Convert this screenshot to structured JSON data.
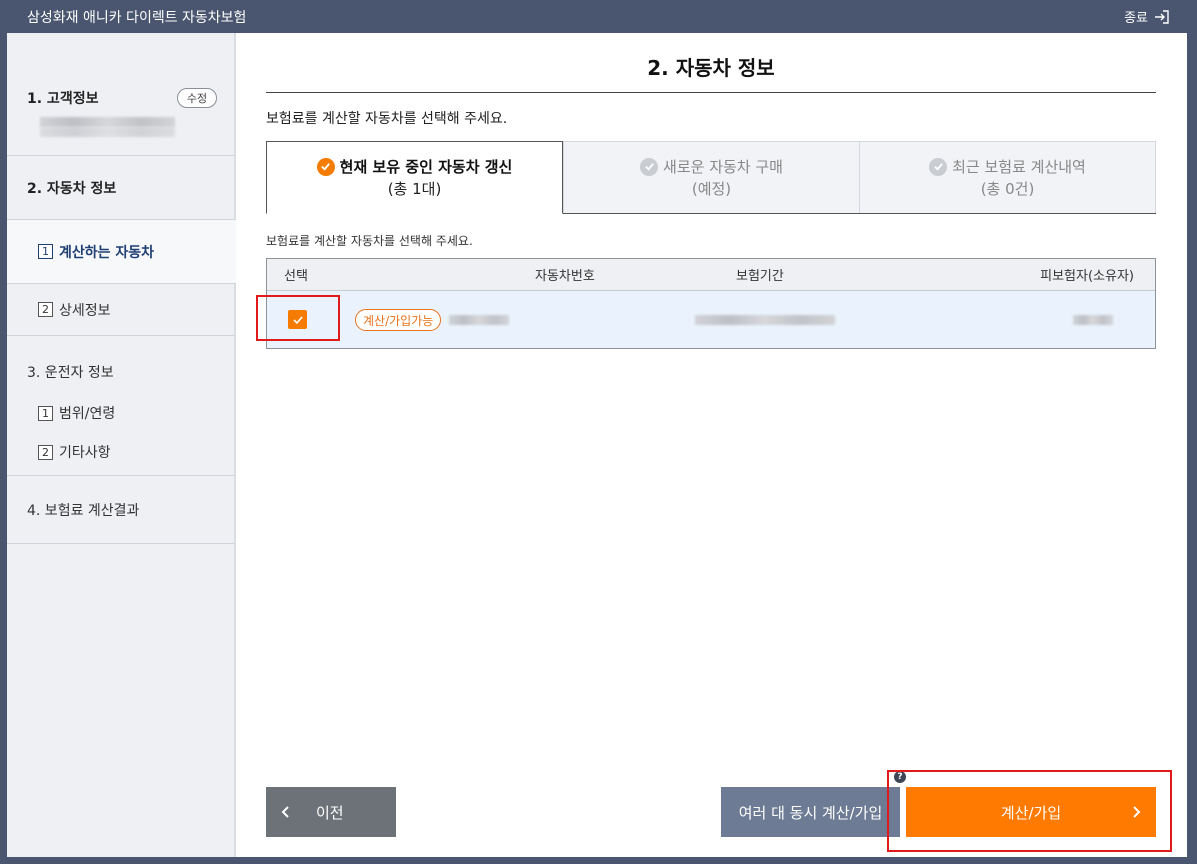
{
  "window_title": "삼성화재 애니카 다이렉트 자동차보험",
  "close_label": "종료",
  "sidebar": {
    "step1": {
      "label": "1. 고객정보",
      "edit_label": "수정"
    },
    "step2": {
      "label": "2. 자동차 정보"
    },
    "step2_subs": [
      {
        "num": "1",
        "label": "계산하는 자동차"
      },
      {
        "num": "2",
        "label": "상세정보"
      }
    ],
    "step3": {
      "label": "3. 운전자 정보",
      "subs": [
        {
          "num": "1",
          "label": "범위/연령"
        },
        {
          "num": "2",
          "label": "기타사항"
        }
      ]
    },
    "step4": {
      "label": "4. 보험료 계산결과"
    }
  },
  "main": {
    "title": "2. 자동차 정보",
    "guide": "보험료를 계산할 자동차를 선택해 주세요.",
    "tabs": [
      {
        "line1": "현재 보유 중인 자동차 갱신",
        "line2": "(총 1대)"
      },
      {
        "line1": "새로운 자동차 구매",
        "line2": "(예정)"
      },
      {
        "line1": "최근 보험료 계산내역",
        "line2": "(총 0건)"
      }
    ],
    "sub_guide": "보험료를 계산할 자동차를 선택해 주세요.",
    "table": {
      "headers": [
        "선택",
        "자동차번호",
        "보험기간",
        "피보험자(소유자)"
      ],
      "row": {
        "badge": "계산/가입가능",
        "checked": true
      }
    },
    "buttons": {
      "prev": "이전",
      "multi": "여러 대 동시 계산/가입",
      "calc": "계산/가입",
      "help": "?"
    }
  },
  "colors": {
    "accent": "#ff7a00",
    "title_bar": "#4a5670",
    "highlight_box": "#e0191b",
    "active_nav": "#1f3f73"
  }
}
